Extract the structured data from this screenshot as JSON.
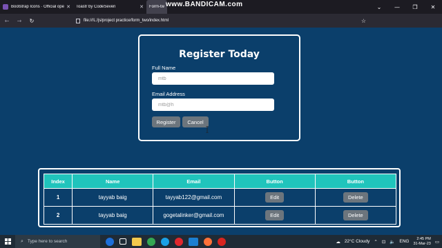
{
  "browser": {
    "tabs": [
      {
        "label": "Bootstrap Icons · Official open ·",
        "favicon_color": "#7952b3",
        "active": false
      },
      {
        "label": "Toastr by CodeSeven",
        "favicon_color": "",
        "active": false
      },
      {
        "label": "Form-two",
        "favicon_color": "",
        "active": true
      }
    ],
    "recorder_watermark": "www.BANDICAM.com",
    "url": "file:///L:/js/project practice/form_two/index.html"
  },
  "form": {
    "title": "Register Today",
    "name_label": "Full Name",
    "name_value": "mtb",
    "email_label": "Email Address",
    "email_value": "mtb@h",
    "register_label": "Register",
    "cancel_label": "Cancel"
  },
  "table": {
    "headers": [
      "Index",
      "Name",
      "Email",
      "Button",
      "Button"
    ],
    "rows": [
      {
        "index": "1",
        "name": "tayyab baig",
        "email": "tayyab122@gmail.com",
        "edit": "Edit",
        "delete": "Delete"
      },
      {
        "index": "2",
        "name": "tayyab baig",
        "email": "gogetalinker@gmail.com",
        "edit": "Edit",
        "delete": "Delete"
      }
    ]
  },
  "taskbar": {
    "search_placeholder": "Type here to search",
    "weather": "22°C  Cloudy",
    "language": "ENG",
    "time": "2:45 PM",
    "date": "31-Mar-23"
  },
  "colors": {
    "page_bg": "#0b3f6b",
    "header_teal": "#20c4bc",
    "button_gray": "#6c757d"
  }
}
